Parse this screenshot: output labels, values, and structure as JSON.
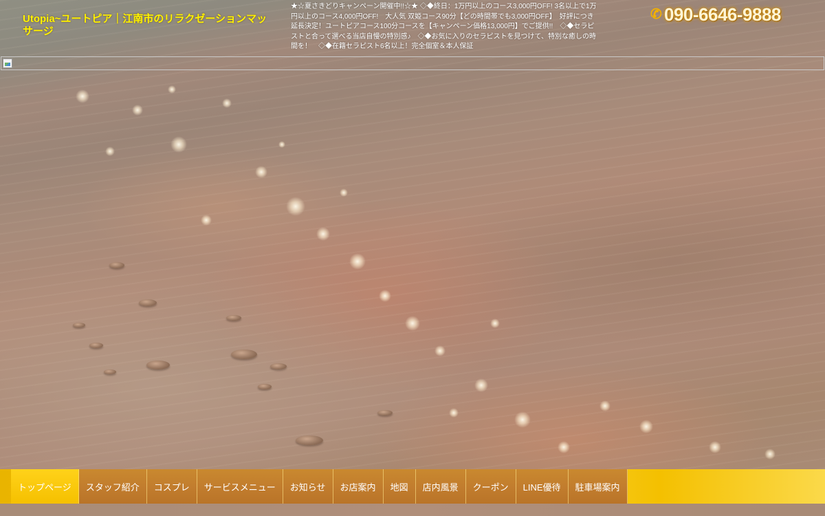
{
  "header": {
    "site_title": "Utopia~ユートピア｜江南市のリラクゼーションマッサージ",
    "promo_text": "★☆夏さきどりキャンペーン開催中!!☆★ ◇◆終日：1万円以上のコース3,000円OFF! 3名以上で1万円以上のコース4,000円OFF!　大人気 双姫コース90分【どの時間帯でも3,000円OFF】　好評につき延長決定！ユートピアコース100分コースを【キャンペーン価格13,000円】でご提供!!　◇◆セラピストと合って選べる当店自慢の特別感♪　◇◆お気に入りのセラピストを見つけて、特別な癒しの時間を！　◇◆在籍セラピスト6名以上！完全個室＆本人保証",
    "phone_icon": "phone-icon",
    "phone_number": "090-6646-9888"
  },
  "nav": {
    "items": [
      {
        "label": "トップページ",
        "active": true
      },
      {
        "label": "スタッフ紹介"
      },
      {
        "label": "コスプレ"
      },
      {
        "label": "サービスメニュー"
      },
      {
        "label": "お知らせ"
      },
      {
        "label": "お店案内"
      },
      {
        "label": "地図"
      },
      {
        "label": "店内風景"
      },
      {
        "label": "クーポン"
      },
      {
        "label": "LINE優待"
      },
      {
        "label": "駐車場案内"
      }
    ]
  },
  "colors": {
    "title_yellow": "#fff200",
    "nav_gold": "#f4c400",
    "nav_item_brown": "#c27d2e",
    "phone_glow": "#d08a00"
  }
}
